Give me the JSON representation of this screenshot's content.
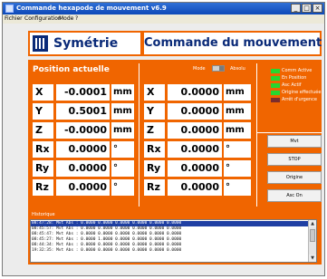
{
  "window": {
    "title": "Commande hexapode de mouvement v6.9",
    "controls": {
      "minimize": "_",
      "maximize": "□",
      "close": "×"
    }
  },
  "menu": [
    "Fichier",
    "Configuration",
    "Mode",
    "?"
  ],
  "banner": {
    "logo_text": "Symétrie",
    "heading": "Commande du mouvement"
  },
  "position": {
    "title": "Position actuelle",
    "mode_label": "Mode",
    "absolute_label": "Absolu",
    "left_table": [
      {
        "axis": "X",
        "value": "-0.0001",
        "unit": "mm"
      },
      {
        "axis": "Y",
        "value": "0.5001",
        "unit": "mm"
      },
      {
        "axis": "Z",
        "value": "-0.0000",
        "unit": "mm"
      },
      {
        "axis": "Rx",
        "value": "0.0000",
        "unit": "°"
      },
      {
        "axis": "Ry",
        "value": "0.0000",
        "unit": "°"
      },
      {
        "axis": "Rz",
        "value": "0.0000",
        "unit": "°"
      }
    ],
    "right_table": [
      {
        "axis": "X",
        "value": "0.0000",
        "unit": "mm"
      },
      {
        "axis": "Y",
        "value": "0.0000",
        "unit": "mm"
      },
      {
        "axis": "Z",
        "value": "0.0000",
        "unit": "mm"
      },
      {
        "axis": "Rx",
        "value": "0.0000",
        "unit": "°"
      },
      {
        "axis": "Ry",
        "value": "0.0000",
        "unit": "°"
      },
      {
        "axis": "Rz",
        "value": "0.0000",
        "unit": "°"
      }
    ]
  },
  "status": [
    {
      "label": "Comm Active",
      "color": "#27d62f"
    },
    {
      "label": "En Position",
      "color": "#27d62f"
    },
    {
      "label": "Asc Actif",
      "color": "#27d62f"
    },
    {
      "label": "Origine effectuée",
      "color": "#27d62f"
    },
    {
      "label": "Arrêt d'urgence",
      "color": "#7b2d2d"
    }
  ],
  "buttons": [
    "Mvt",
    "STOP",
    "Origine",
    "Asc On"
  ],
  "history": {
    "title": "Historique",
    "lines": [
      "08:47:28: Mvt Abs : 0.0000 0.0000 0.0000 0.0000 0.0000 0.0000",
      "08:45:57: Mvt Abs : 0.0000 0.0000 0.0000 0.0000 0.0000 0.0000",
      "08:45:47: Mvt Abs : 0.0000 0.0000 0.0000 0.0000 0.0000 0.0000",
      "08:45:27: Mvt Abs : 0.0000 1.0000 0.0000 0.0000 0.0000 0.0000",
      "08:44:34: Mvt Abs : 0.0000 0.0000 0.0000 0.0000 0.0000 0.0000",
      "19:32:35: Mvt Abs : 0.0000 0.0000 0.0000 0.0000 0.0000 0.0000"
    ]
  }
}
